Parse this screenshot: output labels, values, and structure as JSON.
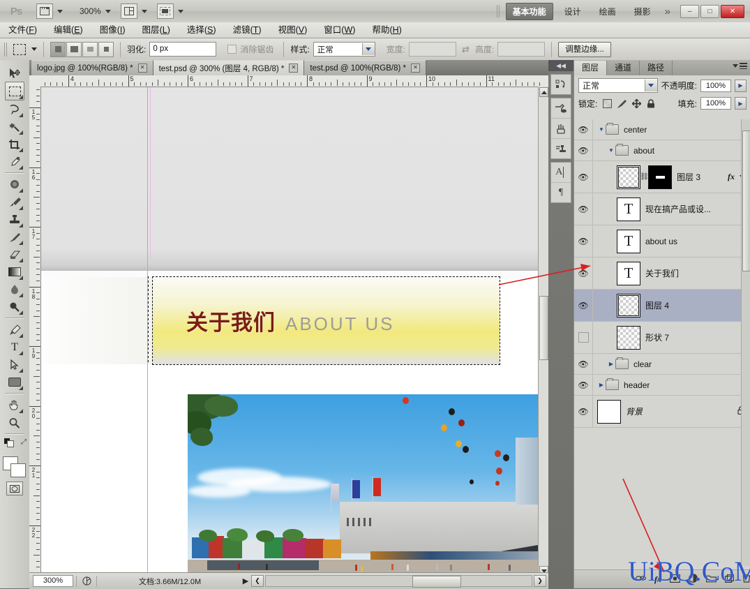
{
  "app": {
    "name": "Adobe Photoshop",
    "logo_text": "Ps",
    "zoom_level": "300%"
  },
  "titlebar": {
    "workspaces": [
      {
        "label": "基本功能",
        "active": true
      },
      {
        "label": "设计",
        "active": false
      },
      {
        "label": "绘画",
        "active": false
      },
      {
        "label": "摄影",
        "active": false
      }
    ],
    "more_label": "»",
    "window_buttons": {
      "minimize": "–",
      "maximize": "□",
      "close": "✕"
    },
    "icons": {
      "bridge": "bridge-icon",
      "arrange": "arrange-documents-icon",
      "screenmode": "screen-mode-icon"
    }
  },
  "menubar": {
    "items": [
      {
        "text": "文件",
        "key": "F"
      },
      {
        "text": "编辑",
        "key": "E"
      },
      {
        "text": "图像",
        "key": "I"
      },
      {
        "text": "图层",
        "key": "L"
      },
      {
        "text": "选择",
        "key": "S"
      },
      {
        "text": "滤镜",
        "key": "T"
      },
      {
        "text": "视图",
        "key": "V"
      },
      {
        "text": "窗口",
        "key": "W"
      },
      {
        "text": "帮助",
        "key": "H"
      }
    ]
  },
  "optionsbar": {
    "tool_icon": "rectangular-marquee-icon",
    "feather_label": "羽化:",
    "feather_value": "0 px",
    "antialias_label": "消除锯齿",
    "antialias_checked": false,
    "style_label": "样式:",
    "style_value": "正常",
    "width_label": "宽度:",
    "width_value": "",
    "height_label": "高度:",
    "height_value": "",
    "swap_icon": "swap-dimensions-icon",
    "refine_edge_label": "调整边缘..."
  },
  "toolbox": {
    "tools": [
      {
        "name": "move-tool",
        "glyph": "✐",
        "selected": false
      },
      {
        "name": "rectangular-marquee-tool",
        "glyph": "",
        "selected": true
      },
      {
        "name": "lasso-tool",
        "glyph": "♒",
        "selected": false
      },
      {
        "name": "magic-wand-tool",
        "glyph": "✷",
        "selected": false
      },
      {
        "name": "crop-tool",
        "glyph": "⌗",
        "selected": false
      },
      {
        "name": "eyedropper-tool",
        "glyph": "✒",
        "selected": false
      },
      {
        "name": "healing-brush-tool",
        "glyph": "✿",
        "selected": false
      },
      {
        "name": "brush-tool",
        "glyph": "✎",
        "selected": false
      },
      {
        "name": "clone-stamp-tool",
        "glyph": "⚓",
        "selected": false
      },
      {
        "name": "history-brush-tool",
        "glyph": "✐",
        "selected": false
      },
      {
        "name": "eraser-tool",
        "glyph": "▱",
        "selected": false
      },
      {
        "name": "gradient-tool",
        "glyph": "▤",
        "selected": false
      },
      {
        "name": "blur-tool",
        "glyph": "●",
        "selected": false
      },
      {
        "name": "dodge-tool",
        "glyph": "⚲",
        "selected": false
      },
      {
        "name": "pen-tool",
        "glyph": "✒",
        "selected": false
      },
      {
        "name": "type-tool",
        "glyph": "T",
        "selected": false
      },
      {
        "name": "path-selection-tool",
        "glyph": "➤",
        "selected": false
      },
      {
        "name": "rectangle-shape-tool",
        "glyph": "▭",
        "selected": false
      },
      {
        "name": "hand-tool",
        "glyph": "✋",
        "selected": false
      },
      {
        "name": "zoom-tool",
        "glyph": "⚲",
        "selected": false
      }
    ],
    "foreground_color": "#ffffff",
    "background_color": "#ffffff",
    "quickmask_name": "quick-mask-toggle"
  },
  "document_tabs": [
    {
      "label": "logo.jpg @ 100%(RGB/8) *",
      "active": false
    },
    {
      "label": "test.psd @ 300% (图层 4, RGB/8) *",
      "active": true
    },
    {
      "label": "test.psd @ 100%(RGB/8) *",
      "active": false
    }
  ],
  "rulers": {
    "horizontal_labels": [
      "4",
      "5",
      "6",
      "7",
      "8",
      "9",
      "10",
      "11"
    ],
    "vertical_labels": [
      "15",
      "16",
      "17",
      "18",
      "19",
      "20",
      "21",
      "22"
    ],
    "unit": "cm"
  },
  "canvas": {
    "banner": {
      "chinese_title": "关于我们",
      "english_title": "ABOUT US",
      "chinese_color": "#7a1d14",
      "english_color": "#9c9c9c",
      "gradient_color": "#f2e97e"
    },
    "photo_alt": "building exterior with blue sky, balloons and flags"
  },
  "statusbar": {
    "zoom": "300%",
    "doc_label": "文档:3.66M/12.0M",
    "preview_icon": "preview-icon",
    "play_icon": "▶",
    "prev_icon": "❮"
  },
  "dock_icons": [
    {
      "name": "history-icon",
      "glyph": "↺"
    },
    {
      "name": "color-swatch-icon",
      "glyph": "✒"
    },
    {
      "name": "brush-presets-icon",
      "glyph": "✎"
    },
    {
      "name": "clone-source-icon",
      "glyph": "⚓"
    },
    {
      "name": "character-panel-icon",
      "glyph": "A"
    },
    {
      "name": "paragraph-panel-icon",
      "glyph": "¶"
    }
  ],
  "layers_panel": {
    "tabs": [
      {
        "label": "图层",
        "active": true
      },
      {
        "label": "通道",
        "active": false
      },
      {
        "label": "路径",
        "active": false
      }
    ],
    "menu_icon": "panel-menu-icon",
    "blend_mode": "正常",
    "opacity_label": "不透明度:",
    "opacity_value": "100%",
    "lock_label": "锁定:",
    "lock_icons": [
      "lock-transparency-icon",
      "lock-pixels-icon",
      "lock-position-icon",
      "lock-all-icon"
    ],
    "fill_label": "填充:",
    "fill_value": "100%",
    "layers": [
      {
        "name": "center",
        "type": "group",
        "depth": 0,
        "visible": true,
        "expanded": true,
        "selected": false
      },
      {
        "name": "about",
        "type": "group",
        "depth": 1,
        "visible": true,
        "expanded": true,
        "selected": false
      },
      {
        "name": "图层 3",
        "type": "pixel-mask",
        "depth": 2,
        "visible": true,
        "selected": false,
        "has_fx": true
      },
      {
        "name": "现在搞产品或设...",
        "type": "text",
        "depth": 2,
        "visible": true,
        "selected": false
      },
      {
        "name": "about us",
        "type": "text",
        "depth": 2,
        "visible": true,
        "selected": false
      },
      {
        "name": "关于我们",
        "type": "text",
        "depth": 2,
        "visible": true,
        "selected": false
      },
      {
        "name": "图层 4",
        "type": "pixel",
        "depth": 2,
        "visible": true,
        "selected": true
      },
      {
        "name": "形状 7",
        "type": "pixel",
        "depth": 2,
        "visible": false,
        "selected": false
      },
      {
        "name": "clear",
        "type": "group",
        "depth": 1,
        "visible": true,
        "expanded": false,
        "selected": false
      },
      {
        "name": "header",
        "type": "group",
        "depth": 0,
        "visible": true,
        "expanded": false,
        "selected": false
      },
      {
        "name": "背景",
        "type": "background",
        "depth": 0,
        "visible": true,
        "selected": false,
        "locked": true
      }
    ],
    "footer_icons": [
      {
        "name": "link-layers-icon",
        "glyph": "⚭"
      },
      {
        "name": "layer-style-icon",
        "glyph": "fx"
      },
      {
        "name": "add-mask-icon",
        "glyph": "▣"
      },
      {
        "name": "adjustment-layer-icon",
        "glyph": "◑"
      },
      {
        "name": "new-group-icon",
        "glyph": "▱"
      },
      {
        "name": "new-layer-icon",
        "glyph": "⧉"
      },
      {
        "name": "delete-layer-icon",
        "glyph": "⌧"
      }
    ]
  },
  "annotations": {
    "arrow_color": "#d81f1f",
    "watermark": "UiBQ.CoM",
    "watermark_color": "#2f58c8"
  }
}
